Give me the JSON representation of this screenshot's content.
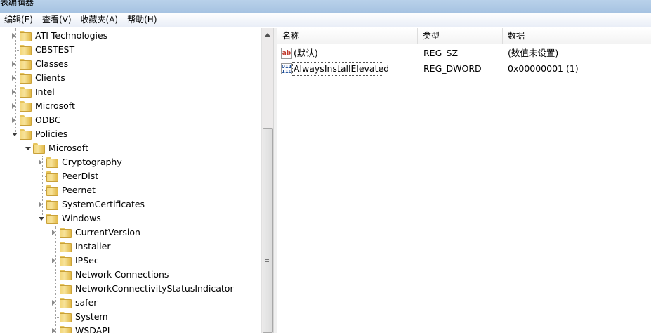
{
  "window": {
    "title": "表编辑器"
  },
  "menu": [
    "编辑(E)",
    "查看(V)",
    "收藏夹(A)",
    "帮助(H)"
  ],
  "tree": {
    "items": [
      {
        "label": "ATI Technologies",
        "level": 0,
        "expander": "collapsed"
      },
      {
        "label": "CBSTEST",
        "level": 0,
        "expander": "none"
      },
      {
        "label": "Classes",
        "level": 0,
        "expander": "collapsed"
      },
      {
        "label": "Clients",
        "level": 0,
        "expander": "collapsed"
      },
      {
        "label": "Intel",
        "level": 0,
        "expander": "collapsed"
      },
      {
        "label": "Microsoft",
        "level": 0,
        "expander": "collapsed"
      },
      {
        "label": "ODBC",
        "level": 0,
        "expander": "collapsed"
      },
      {
        "label": "Policies",
        "level": 0,
        "expander": "expanded"
      },
      {
        "label": "Microsoft",
        "level": 1,
        "expander": "expanded"
      },
      {
        "label": "Cryptography",
        "level": 2,
        "expander": "collapsed"
      },
      {
        "label": "PeerDist",
        "level": 2,
        "expander": "none"
      },
      {
        "label": "Peernet",
        "level": 2,
        "expander": "none"
      },
      {
        "label": "SystemCertificates",
        "level": 2,
        "expander": "collapsed"
      },
      {
        "label": "Windows",
        "level": 2,
        "expander": "expanded"
      },
      {
        "label": "CurrentVersion",
        "level": 3,
        "expander": "collapsed"
      },
      {
        "label": "Installer",
        "level": 3,
        "expander": "none",
        "selected": true
      },
      {
        "label": "IPSec",
        "level": 3,
        "expander": "collapsed"
      },
      {
        "label": "Network Connections",
        "level": 3,
        "expander": "none"
      },
      {
        "label": "NetworkConnectivityStatusIndicator",
        "level": 3,
        "expander": "none"
      },
      {
        "label": "safer",
        "level": 3,
        "expander": "collapsed"
      },
      {
        "label": "System",
        "level": 3,
        "expander": "none"
      },
      {
        "label": "WSDAPI",
        "level": 3,
        "expander": "collapsed"
      }
    ]
  },
  "list": {
    "columns": [
      "名称",
      "类型",
      "数据"
    ],
    "rows": [
      {
        "name": "(默认)",
        "type": "REG_SZ",
        "data": "(数值未设置)",
        "icon": "string-value-icon",
        "icon_text": "ab"
      },
      {
        "name": "AlwaysInstallElevated",
        "type": "REG_DWORD",
        "data": "0x00000001 (1)",
        "icon": "binary-value-icon",
        "icon_text": "011 110"
      }
    ]
  },
  "colors": {
    "selection_outline": "#e03030",
    "folder": "#f3d77b"
  }
}
